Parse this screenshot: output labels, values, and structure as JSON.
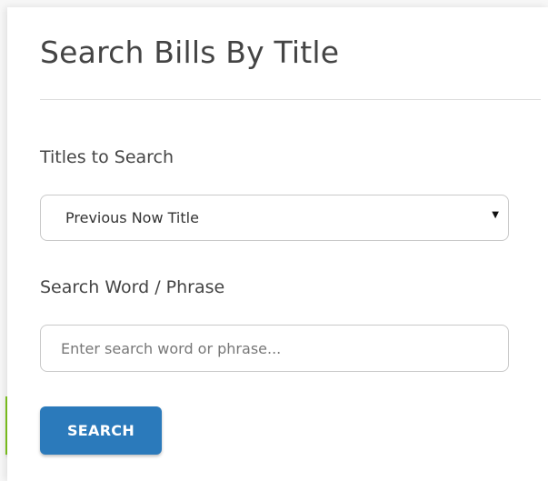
{
  "header": {
    "title": "Search Bills By Title"
  },
  "titles_to_search": {
    "label": "Titles to Search",
    "selected_value": "Previous Now Title",
    "caret_icon": "caret-down-icon"
  },
  "search_phrase": {
    "label": "Search Word / Phrase",
    "placeholder": "Enter search word or phrase...",
    "value": ""
  },
  "actions": {
    "search_label": "SEARCH"
  },
  "colors": {
    "button": "#2b7abb",
    "accent_bar": "#7ec51f",
    "text": "#444444"
  }
}
